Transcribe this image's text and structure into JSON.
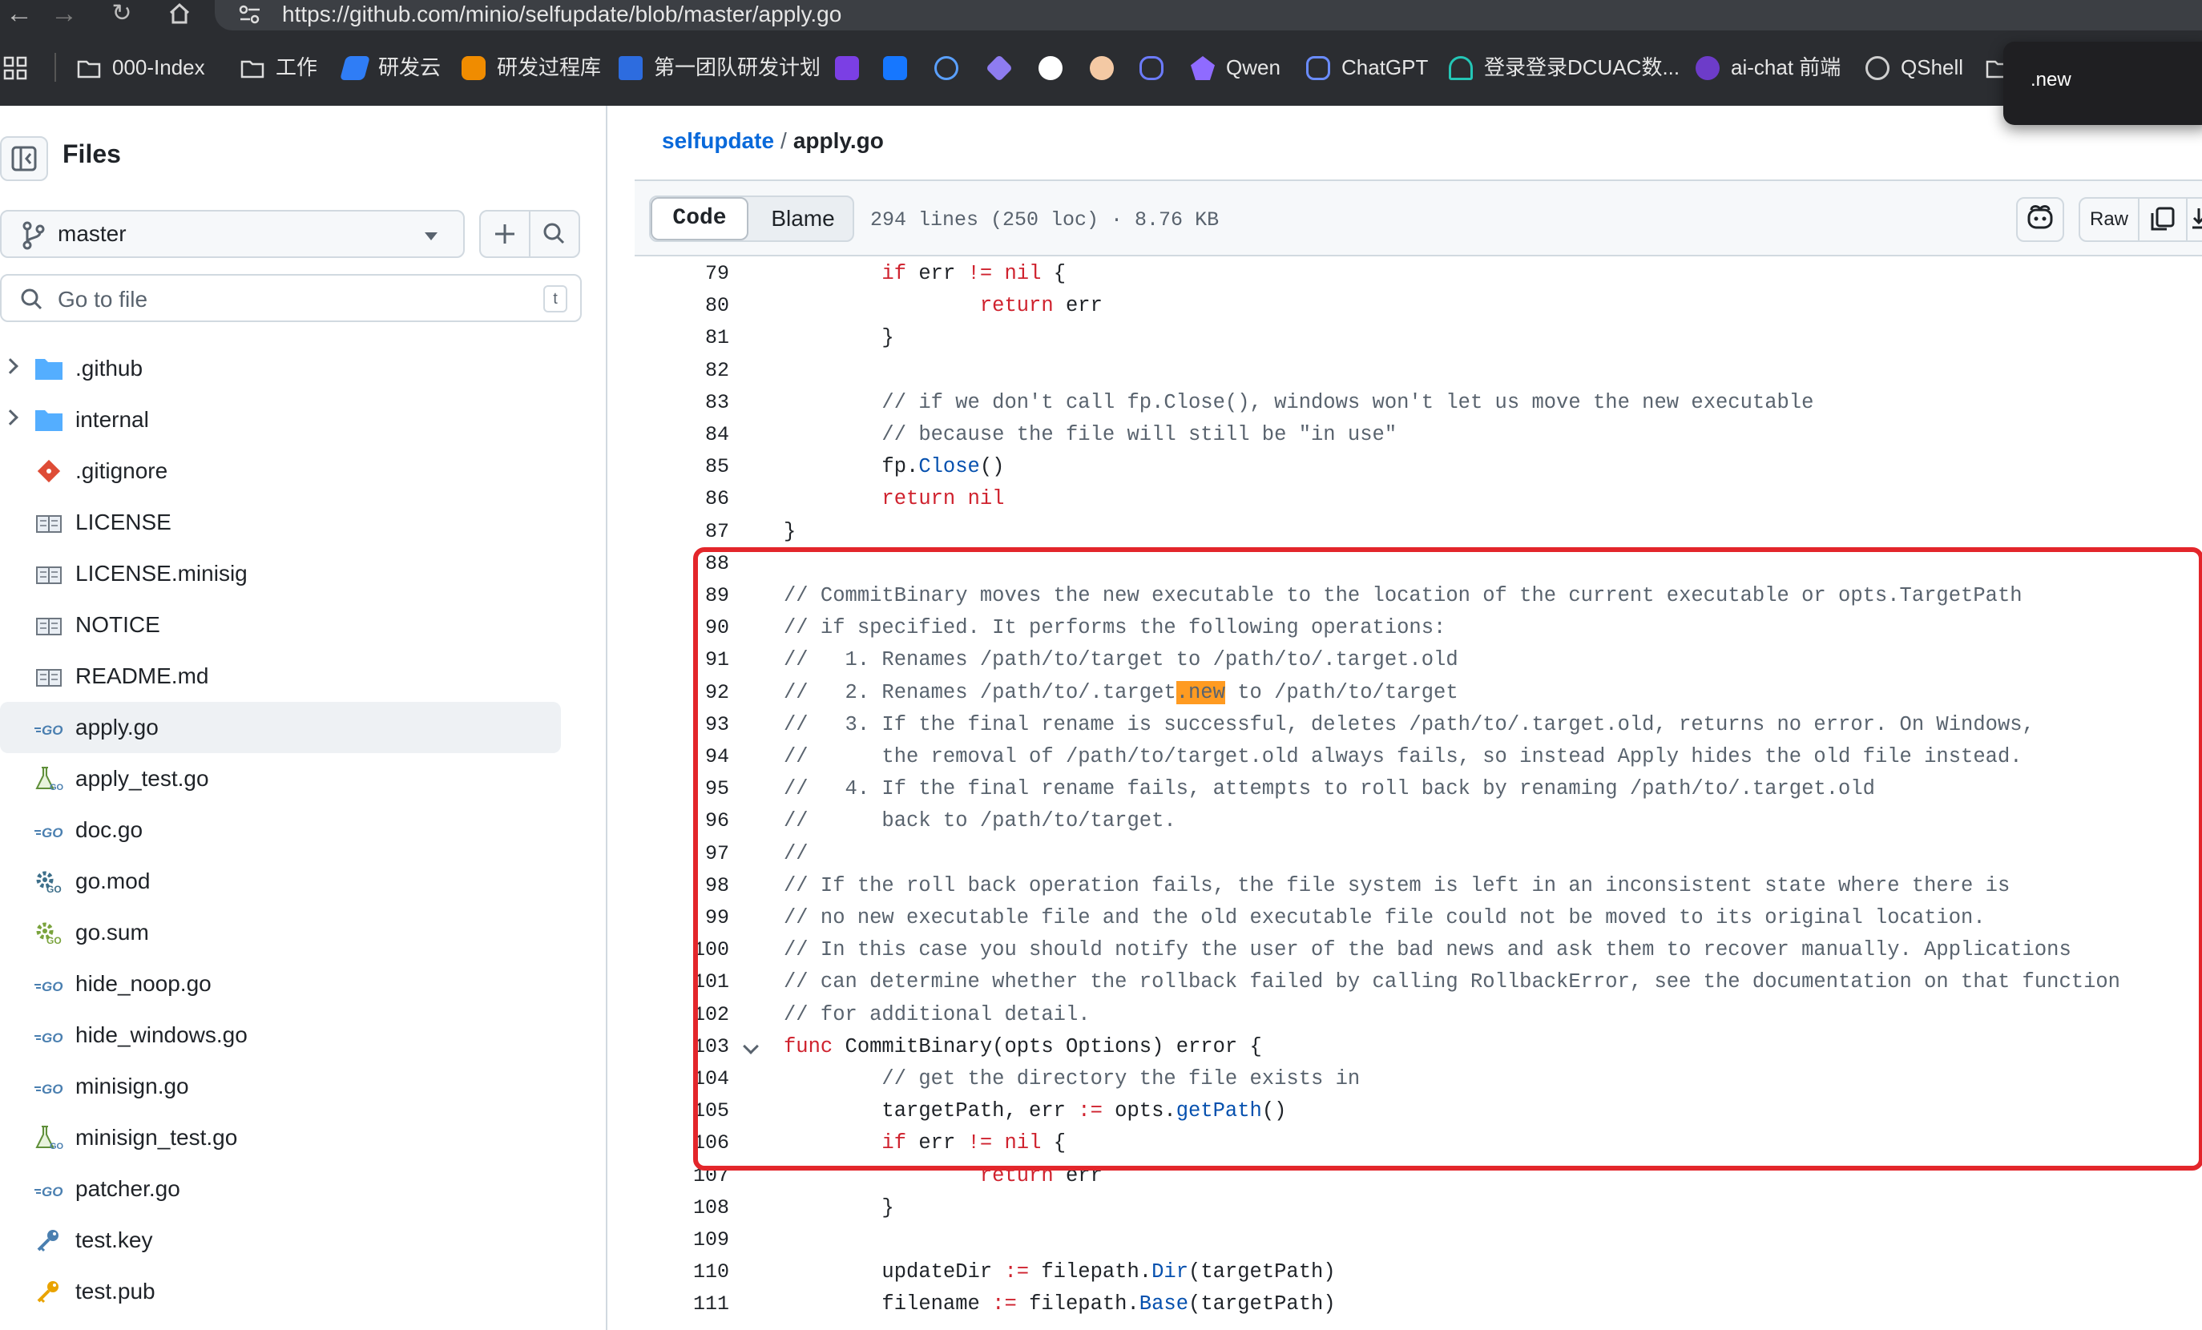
{
  "browser": {
    "url": "https://github.com/minio/selfupdate/blob/master/apply.go",
    "bookmarks": [
      {
        "label": "000-Index",
        "icon": "folder-icon"
      },
      {
        "label": "工作",
        "icon": "folder-icon"
      },
      {
        "label": "研发云",
        "icon": "app-icon"
      },
      {
        "label": "研发过程库",
        "icon": "app-icon"
      },
      {
        "label": "第一团队研发计划",
        "icon": "doc-icon"
      },
      {
        "label": "Qwen",
        "icon": "qwen-icon"
      },
      {
        "label": "ChatGPT",
        "icon": "chatgpt-icon"
      },
      {
        "label": "登录登录DCUAC数...",
        "icon": "shield-icon"
      },
      {
        "label": "ai-chat 前端",
        "icon": "app-icon"
      },
      {
        "label": "QShell",
        "icon": "globe-icon"
      }
    ],
    "popup_text": ".new"
  },
  "sidebar": {
    "title": "Files",
    "branch": "master",
    "search_placeholder": "Go to file",
    "search_shortcut": "t",
    "items": [
      {
        "name": ".github",
        "kind": "folder"
      },
      {
        "name": "internal",
        "kind": "folder"
      },
      {
        "name": ".gitignore",
        "kind": "git"
      },
      {
        "name": "LICENSE",
        "kind": "book"
      },
      {
        "name": "LICENSE.minisig",
        "kind": "book"
      },
      {
        "name": "NOTICE",
        "kind": "book"
      },
      {
        "name": "README.md",
        "kind": "book"
      },
      {
        "name": "apply.go",
        "kind": "go"
      },
      {
        "name": "apply_test.go",
        "kind": "test"
      },
      {
        "name": "doc.go",
        "kind": "go"
      },
      {
        "name": "go.mod",
        "kind": "gomod"
      },
      {
        "name": "go.sum",
        "kind": "gosum"
      },
      {
        "name": "hide_noop.go",
        "kind": "go"
      },
      {
        "name": "hide_windows.go",
        "kind": "go"
      },
      {
        "name": "minisign.go",
        "kind": "go"
      },
      {
        "name": "minisign_test.go",
        "kind": "test"
      },
      {
        "name": "patcher.go",
        "kind": "go"
      },
      {
        "name": "test.key",
        "kind": "key"
      },
      {
        "name": "test.pub",
        "kind": "key"
      }
    ]
  },
  "header": {
    "repo": "selfupdate",
    "separator": "/",
    "file": "apply.go"
  },
  "toolbar": {
    "code_tab": "Code",
    "blame_tab": "Blame",
    "file_info": "294 lines (250 loc) · 8.76 KB",
    "raw_label": "Raw"
  },
  "code": {
    "lines": [
      {
        "n": "79",
        "text": "\t\tif err != nil {"
      },
      {
        "n": "80",
        "text": "\t\t\treturn err"
      },
      {
        "n": "81",
        "text": "\t\t}"
      },
      {
        "n": "82",
        "text": ""
      },
      {
        "n": "83",
        "text": "\t\t// if we don't call fp.Close(), windows won't let us move the new executable"
      },
      {
        "n": "84",
        "text": "\t\t// because the file will still be \"in use\""
      },
      {
        "n": "85",
        "text": "\t\tfp.Close()"
      },
      {
        "n": "86",
        "text": "\t\treturn nil"
      },
      {
        "n": "87",
        "text": "\t}"
      },
      {
        "n": "88",
        "text": ""
      },
      {
        "n": "89",
        "text": "\t// CommitBinary moves the new executable to the location of the current executable or opts.TargetPath"
      },
      {
        "n": "90",
        "text": "\t// if specified. It performs the following operations:"
      },
      {
        "n": "91",
        "text": "\t//   1. Renames /path/to/target to /path/to/.target.old"
      },
      {
        "n": "92",
        "text": "\t//   2. Renames /path/to/.target.new to /path/to/target"
      },
      {
        "n": "93",
        "text": "\t//   3. If the final rename is successful, deletes /path/to/.target.old, returns no error. On Windows,"
      },
      {
        "n": "94",
        "text": "\t//      the removal of /path/to/target.old always fails, so instead Apply hides the old file instead."
      },
      {
        "n": "95",
        "text": "\t//   4. If the final rename fails, attempts to roll back by renaming /path/to/.target.old"
      },
      {
        "n": "96",
        "text": "\t//      back to /path/to/target."
      },
      {
        "n": "97",
        "text": "\t//"
      },
      {
        "n": "98",
        "text": "\t// If the roll back operation fails, the file system is left in an inconsistent state where there is"
      },
      {
        "n": "99",
        "text": "\t// no new executable file and the old executable file could not be moved to its original location."
      },
      {
        "n": "100",
        "text": "\t// In this case you should notify the user of the bad news and ask them to recover manually. Applications"
      },
      {
        "n": "101",
        "text": "\t// can determine whether the rollback failed by calling RollbackError, see the documentation on that function"
      },
      {
        "n": "102",
        "text": "\t// for additional detail."
      },
      {
        "n": "103",
        "text": "\tfunc CommitBinary(opts Options) error {"
      },
      {
        "n": "104",
        "text": "\t\t// get the directory the file exists in"
      },
      {
        "n": "105",
        "text": "\t\ttargetPath, err := opts.getPath()"
      },
      {
        "n": "106",
        "text": "\t\tif err != nil {"
      },
      {
        "n": "107",
        "text": "\t\t\treturn err"
      },
      {
        "n": "108",
        "text": "\t\t}"
      },
      {
        "n": "109",
        "text": ""
      },
      {
        "n": "110",
        "text": "\t\tupdateDir := filepath.Dir(targetPath)"
      },
      {
        "n": "111",
        "text": "\t\tfilename := filepath.Base(targetPath)"
      }
    ],
    "search_highlight": ".new",
    "annotation_color": "#e3262b"
  }
}
